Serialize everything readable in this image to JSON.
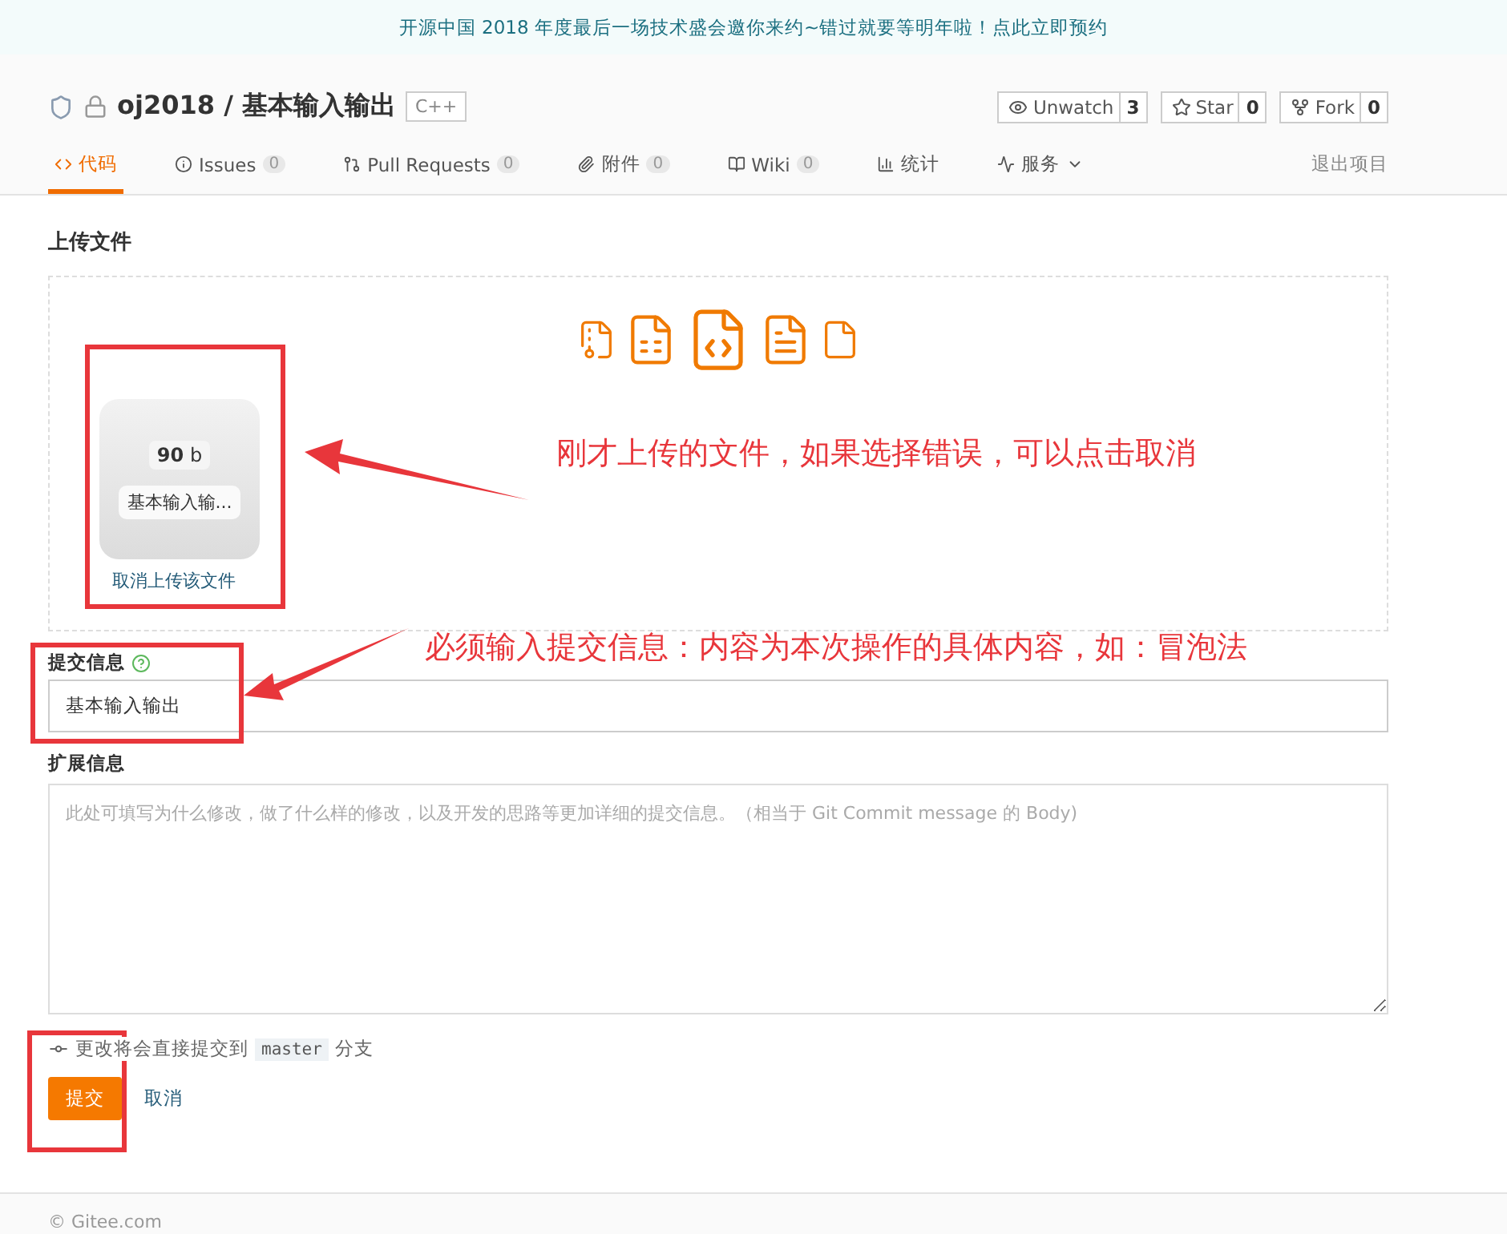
{
  "banner": {
    "text": "开源中国 2018 年度最后一场技术盛会邀你来约~错过就要等明年啦！点此立即预约"
  },
  "repo": {
    "title": "oj2018 / 基本输入输出",
    "language": "C++",
    "private": true
  },
  "actions": [
    {
      "label": "Unwatch",
      "count": "3"
    },
    {
      "label": "Star",
      "count": "0"
    },
    {
      "label": "Fork",
      "count": "0"
    }
  ],
  "tabs": [
    {
      "label": "代码",
      "selected": true,
      "dropdown": false
    },
    {
      "label": "Issues",
      "count": "0",
      "selected": false,
      "dropdown": false
    },
    {
      "label": "Pull Requests",
      "count": "0",
      "selected": false,
      "dropdown": false
    },
    {
      "label": "附件",
      "count": "0",
      "selected": false,
      "dropdown": false
    },
    {
      "label": "Wiki",
      "count": "0",
      "selected": false,
      "dropdown": false
    },
    {
      "label": "统计",
      "selected": false,
      "dropdown": false
    },
    {
      "label": "服务",
      "selected": false,
      "dropdown": true
    }
  ],
  "quit_link": "退出项目",
  "upload": {
    "title": "上传文件",
    "files": [
      {
        "size": "90",
        "unit": "b",
        "name": "基本输入输...",
        "remove": "取消上传该文件"
      }
    ]
  },
  "form": {
    "message_label": "提交信息",
    "message_value": "基本输入输出",
    "body_label": "扩展信息",
    "body_placeholder": "此处可填写为什么修改，做了什么样的修改，以及开发的思路等更加详细的提交信息。（相当于 Git Commit message 的 Body)",
    "branch_note_before": "更改将会直接提交到",
    "branch": "master",
    "branch_note_after": "分支",
    "submit": "提交",
    "cancel": "取消"
  },
  "footer": {
    "text": "© Gitee.com"
  },
  "annotations": [
    {
      "text": "刚才上传的文件，如果选择错误，可以点击取消"
    },
    {
      "text": "必须输入提交信息：内容为本次操作的具体内容，如：冒泡法"
    }
  ]
}
